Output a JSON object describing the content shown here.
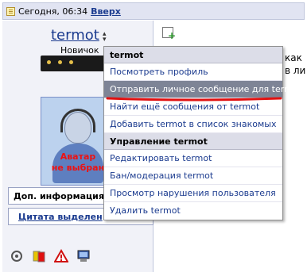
{
  "topbar": {
    "date_text": "Сегодня, 06:34",
    "top_link": "Вверх"
  },
  "user": {
    "username": "termot",
    "rank": "Новичок",
    "avatar_text_line1": "Аватар",
    "avatar_text_line2": "не выбран"
  },
  "panel": {
    "dop_info": "Доп. информация",
    "quote_link": "Цитата выделен"
  },
  "content": {
    "line1": "как",
    "line2": "в ли"
  },
  "menu": {
    "header": "termot",
    "items": [
      "Посмотреть профиль",
      "Отправить личное сообщение для termot",
      "Найти ещё сообщения от termot",
      "Добавить termot в список знакомых"
    ],
    "manage_header": "Управление termot",
    "manage_items": [
      "Редактировать termot",
      "Бан/модерация termot",
      "Просмотр нарушения пользователя",
      "Удалить termot"
    ]
  },
  "colors": {
    "link": "#1b3b8f",
    "active_item_bg": "#7e8496",
    "highlight_red": "#e11111"
  },
  "icons": [
    "post-icon",
    "new-post-icon",
    "user-tools-icon",
    "warn-card-icon",
    "report-icon",
    "computer-icon",
    "dropdown-arrow-icon"
  ]
}
